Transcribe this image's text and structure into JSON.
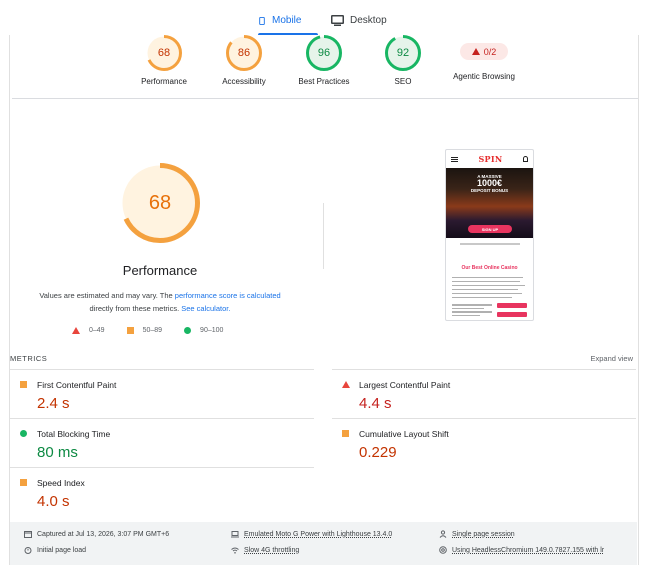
{
  "tabs": {
    "mobile_label": "Mobile",
    "desktop_label": "Desktop"
  },
  "gauges": [
    {
      "score": "68",
      "label": "Performance",
      "color": "#f4a13f",
      "fraction": 0.68
    },
    {
      "score": "86",
      "label": "Accessibility",
      "color": "#f4a13f",
      "fraction": 0.86
    },
    {
      "score": "96",
      "label": "Best Practices",
      "color": "#18b663",
      "fraction": 0.96
    },
    {
      "score": "92",
      "label": "SEO",
      "color": "#18b663",
      "fraction": 0.92
    }
  ],
  "agentic": {
    "score": "0/2",
    "label": "Agentic Browsing"
  },
  "performance": {
    "score": "68",
    "fraction": 0.68,
    "title": "Performance",
    "desc_pre": "Values are estimated and may vary. The ",
    "desc_link1": "performance score is calculated",
    "desc_mid": " directly from these metrics. ",
    "desc_link2": "See calculator."
  },
  "legend": {
    "fail": "0–49",
    "average": "50–89",
    "pass": "90–100"
  },
  "screenshot": {
    "logo": "SPIN",
    "hero_line1": "A MASSIVE",
    "hero_line2": "1000€",
    "hero_line3": "DEPOSIT BONUS",
    "button": "SIGN UP",
    "subtitle": "Our Best Online Casino"
  },
  "metrics": {
    "title": "METRICS",
    "expand": "Expand view",
    "items": [
      {
        "label": "First Contentful Paint",
        "value": "2.4 s"
      },
      {
        "label": "Largest Contentful Paint",
        "value": "4.4 s"
      },
      {
        "label": "Total Blocking Time",
        "value": "80 ms"
      },
      {
        "label": "Cumulative Layout Shift",
        "value": "0.229"
      },
      {
        "label": "Speed Index",
        "value": "4.0 s"
      }
    ]
  },
  "footer": {
    "captured": "Captured at Jul 13, 2026, 3:07 PM GMT+6",
    "load": "Initial page load",
    "device": "Emulated Moto G Power with Lighthouse 13.4.0",
    "throttle": "Slow 4G throttling",
    "session": "Single page session",
    "browser": "Using HeadlessChromium 149.0.7827.155 with lr"
  }
}
